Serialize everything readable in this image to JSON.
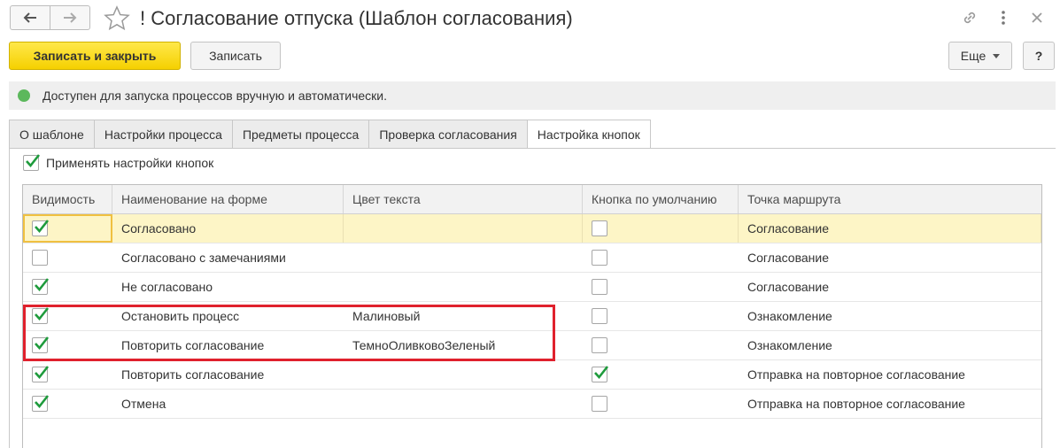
{
  "window": {
    "title": "! Согласование отпуска (Шаблон согласования)"
  },
  "toolbar": {
    "save_close_label": "Записать и закрыть",
    "save_label": "Записать",
    "more_label": "Еще",
    "help_label": "?"
  },
  "status": {
    "text": "Доступен для запуска процессов вручную и автоматически.",
    "color": "#5cb85c"
  },
  "tabs": [
    {
      "label": "О шаблоне",
      "active": false
    },
    {
      "label": "Настройки процесса",
      "active": false
    },
    {
      "label": "Предметы процесса",
      "active": false
    },
    {
      "label": "Проверка согласования",
      "active": false
    },
    {
      "label": "Настройка кнопок",
      "active": true
    }
  ],
  "apply_settings": {
    "label": "Применять настройки кнопок",
    "checked": true
  },
  "table": {
    "columns": [
      "Видимость",
      "Наименование на форме",
      "Цвет текста",
      "Кнопка по умолчанию",
      "Точка маршрута"
    ],
    "rows": [
      {
        "visible": true,
        "name": "Согласовано",
        "color": "",
        "default": false,
        "route": "Согласование",
        "selected": true
      },
      {
        "visible": false,
        "name": "Согласовано с замечаниями",
        "color": "",
        "default": false,
        "route": "Согласование",
        "selected": false
      },
      {
        "visible": true,
        "name": "Не согласовано",
        "color": "",
        "default": false,
        "route": "Согласование",
        "selected": false
      },
      {
        "visible": true,
        "name": "Остановить процесс",
        "color": "Малиновый",
        "default": false,
        "route": "Ознакомление",
        "selected": false
      },
      {
        "visible": true,
        "name": "Повторить согласование",
        "color": "ТемноОливковоЗеленый",
        "default": false,
        "route": "Ознакомление",
        "selected": false
      },
      {
        "visible": true,
        "name": "Повторить согласование",
        "color": "",
        "default": true,
        "route": "Отправка на повторное согласование",
        "selected": false
      },
      {
        "visible": true,
        "name": "Отмена",
        "color": "",
        "default": false,
        "route": "Отправка на повторное согласование",
        "selected": false
      }
    ]
  },
  "colors": {
    "accent_yellow": "#f5d000",
    "check_green": "#1e9b3c",
    "selected_row": "#fdf5c6",
    "highlight_red": "#e0212d"
  }
}
